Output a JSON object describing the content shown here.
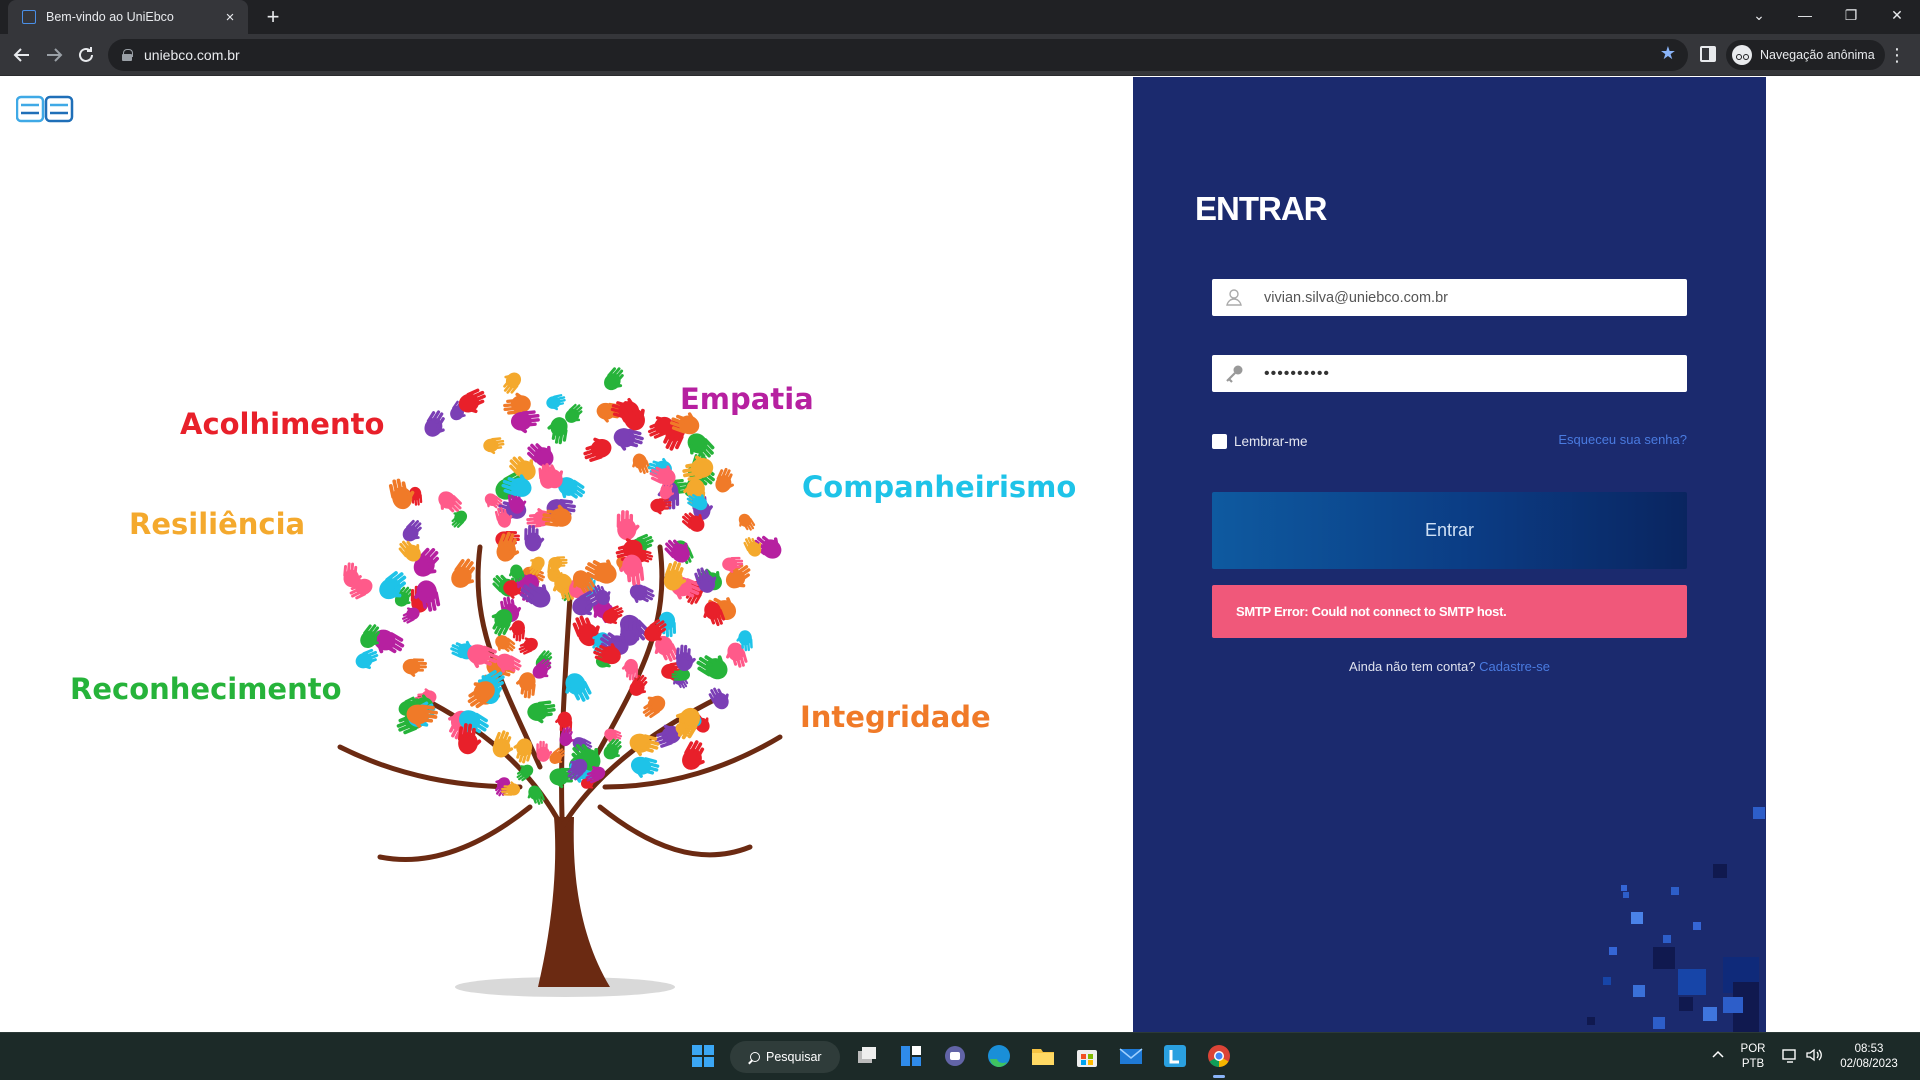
{
  "browser": {
    "tab_title": "Bem-vindo ao UniEbco",
    "tab_close": "×",
    "new_tab": "+",
    "url": "uniebco.com.br",
    "incognito_label": "Navegação anônima",
    "menu_icon": "⋮",
    "window_controls": {
      "dropdown": "⌄",
      "minimize": "—",
      "restore": "❐",
      "close": "✕"
    }
  },
  "logo": {
    "text": "EB",
    "colors": [
      "#3fa9e6",
      "#1f6fb8"
    ]
  },
  "values_tree": {
    "words": [
      {
        "text": "Acolhimento",
        "color": "#e8202a"
      },
      {
        "text": "Empatia",
        "color": "#b620a0"
      },
      {
        "text": "Companheirismo",
        "color": "#1ec3e8"
      },
      {
        "text": "Resiliência",
        "color": "#f4a92d"
      },
      {
        "text": "Reconhecimento",
        "color": "#26b33a"
      },
      {
        "text": "Integridade",
        "color": "#f07a28"
      }
    ]
  },
  "login": {
    "title": "ENTRAR",
    "email_value": "vivian.silva@uniebco.com.br",
    "password_value": "••••••••••",
    "remember_label": "Lembrar-me",
    "forgot_label": "Esqueceu sua senha?",
    "submit_label": "Entrar",
    "error_message": "SMTP Error: Could not connect to SMTP host.",
    "signup_prompt": "Ainda não tem conta?",
    "signup_link": "Cadastre-se",
    "colors": {
      "panel_bg": "#1b2a6e",
      "error_bg": "#f0587a",
      "link": "#4a7be0"
    }
  },
  "taskbar": {
    "search_label": "Pesquisar",
    "language_line1": "POR",
    "language_line2": "PTB",
    "time": "08:53",
    "date": "02/08/2023",
    "apps": [
      "windows-start-icon",
      "search",
      "task-view-icon",
      "widgets-icon",
      "teams-chat-icon",
      "edge-icon",
      "file-explorer-icon",
      "microsoft-store-icon",
      "mail-icon",
      "l-app-icon",
      "chrome-icon"
    ]
  }
}
